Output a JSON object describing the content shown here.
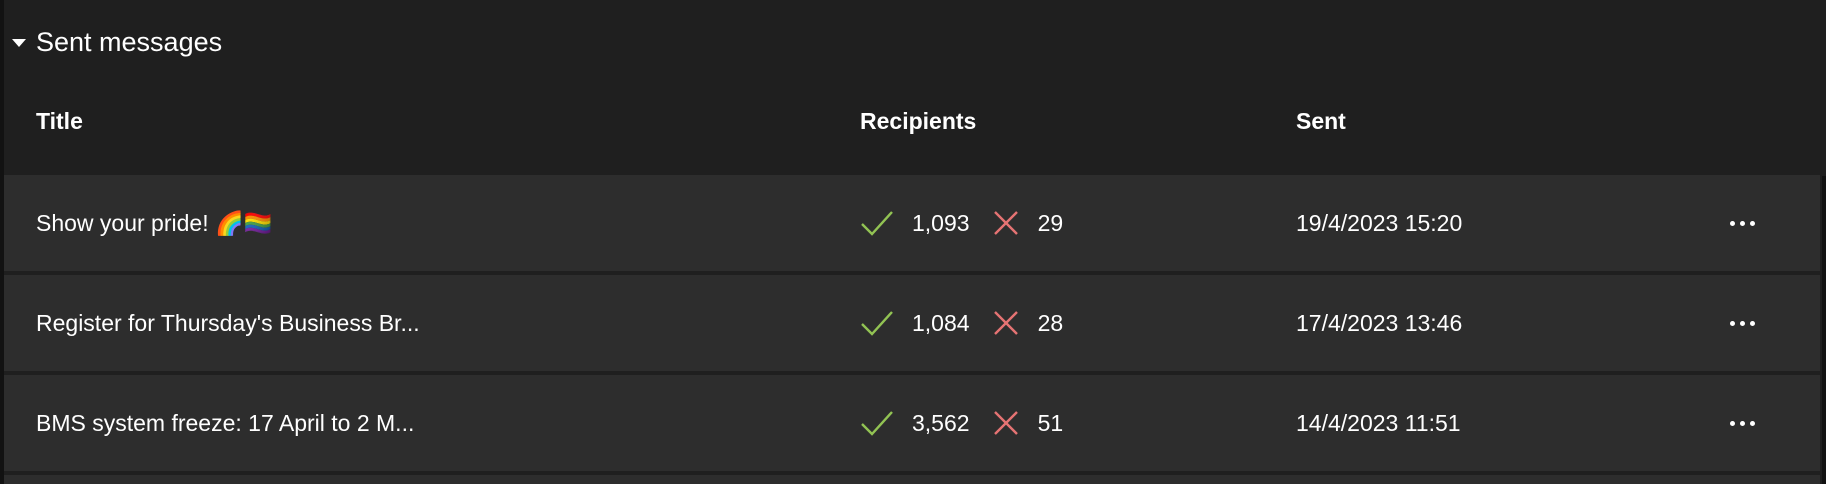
{
  "section": {
    "title": "Sent messages"
  },
  "columns": {
    "title": "Title",
    "recipients": "Recipients",
    "sent": "Sent"
  },
  "rows": [
    {
      "title": "Show your pride! 🌈🏳️‍🌈",
      "success_count": "1,093",
      "failed_count": "29",
      "sent": "19/4/2023 15:20"
    },
    {
      "title": "Register for Thursday's Business Br...",
      "success_count": "1,084",
      "failed_count": "28",
      "sent": "17/4/2023 13:46"
    },
    {
      "title": "BMS system freeze: 17 April to 2 M...",
      "success_count": "3,562",
      "failed_count": "51",
      "sent": "14/4/2023 11:51"
    }
  ],
  "icons": {
    "caret": "chevron-down-icon",
    "success": "checkmark-icon",
    "failed": "close-icon",
    "more": "more-options-icon"
  },
  "colors": {
    "background": "#1f1f1f",
    "row_background": "#2d2d2d",
    "success": "#92c353",
    "failed": "#e57373"
  }
}
